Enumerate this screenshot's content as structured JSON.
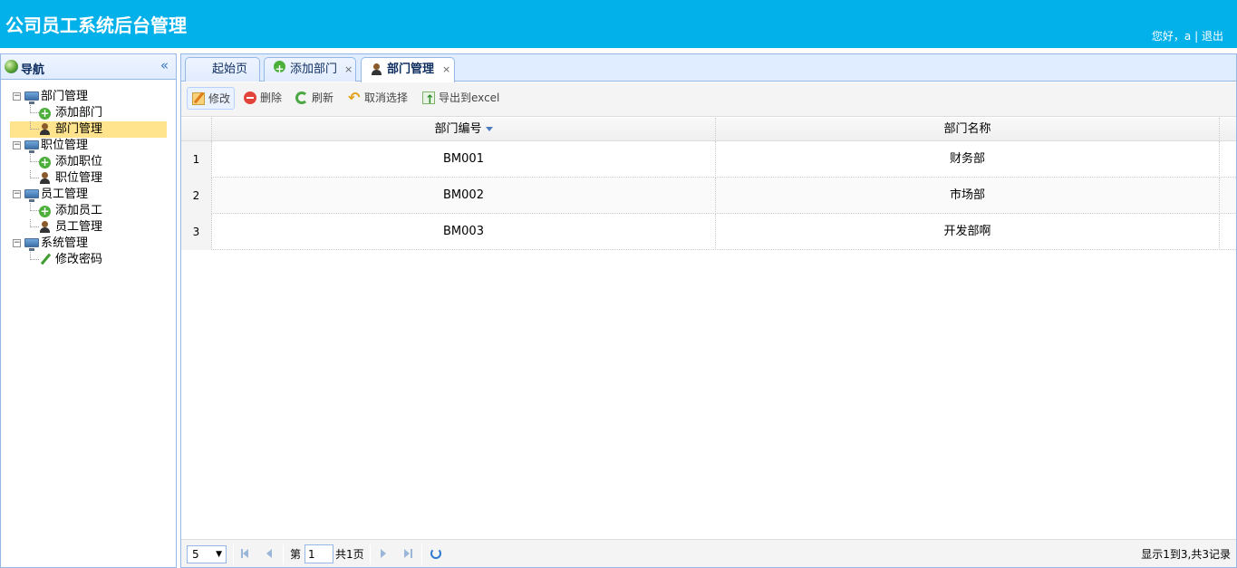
{
  "header": {
    "title": "公司员工系统后台管理",
    "greeting": "您好，a",
    "separator": "|",
    "logout": "退出"
  },
  "nav": {
    "title": "导航",
    "collapse_glyph": "«",
    "groups": [
      {
        "label": "部门管理",
        "children": [
          {
            "label": "添加部门",
            "icon": "add-icon"
          },
          {
            "label": "部门管理",
            "icon": "user-icon",
            "selected": true
          }
        ]
      },
      {
        "label": "职位管理",
        "children": [
          {
            "label": "添加职位",
            "icon": "add-icon"
          },
          {
            "label": "职位管理",
            "icon": "user-icon"
          }
        ]
      },
      {
        "label": "员工管理",
        "children": [
          {
            "label": "添加员工",
            "icon": "add-icon"
          },
          {
            "label": "员工管理",
            "icon": "user-icon"
          }
        ]
      },
      {
        "label": "系统管理",
        "children": [
          {
            "label": "修改密码",
            "icon": "pencil-icon"
          }
        ]
      }
    ]
  },
  "tabs": [
    {
      "label": "起始页",
      "closable": false,
      "active": false
    },
    {
      "label": "添加部门",
      "closable": true,
      "active": false
    },
    {
      "label": "部门管理",
      "closable": true,
      "active": true
    }
  ],
  "tab_close_glyph": "×",
  "toolbar": {
    "edit": "修改",
    "delete": "删除",
    "refresh": "刷新",
    "cancel_selection": "取消选择",
    "export": "导出到excel"
  },
  "grid": {
    "columns": [
      "部门编号",
      "部门名称"
    ],
    "rows": [
      {
        "num": "1",
        "code": "BM001",
        "name": "财务部"
      },
      {
        "num": "2",
        "code": "BM002",
        "name": "市场部"
      },
      {
        "num": "3",
        "code": "BM003",
        "name": "开发部啊"
      }
    ]
  },
  "pager": {
    "page_size": "5",
    "page_prefix": "第",
    "page_value": "1",
    "page_total": "共1页",
    "info": "显示1到3,共3记录"
  },
  "colors": {
    "header_bg": "#02b0ea",
    "panel_border": "#95b8e7",
    "selected_row": "#ffe48d"
  }
}
